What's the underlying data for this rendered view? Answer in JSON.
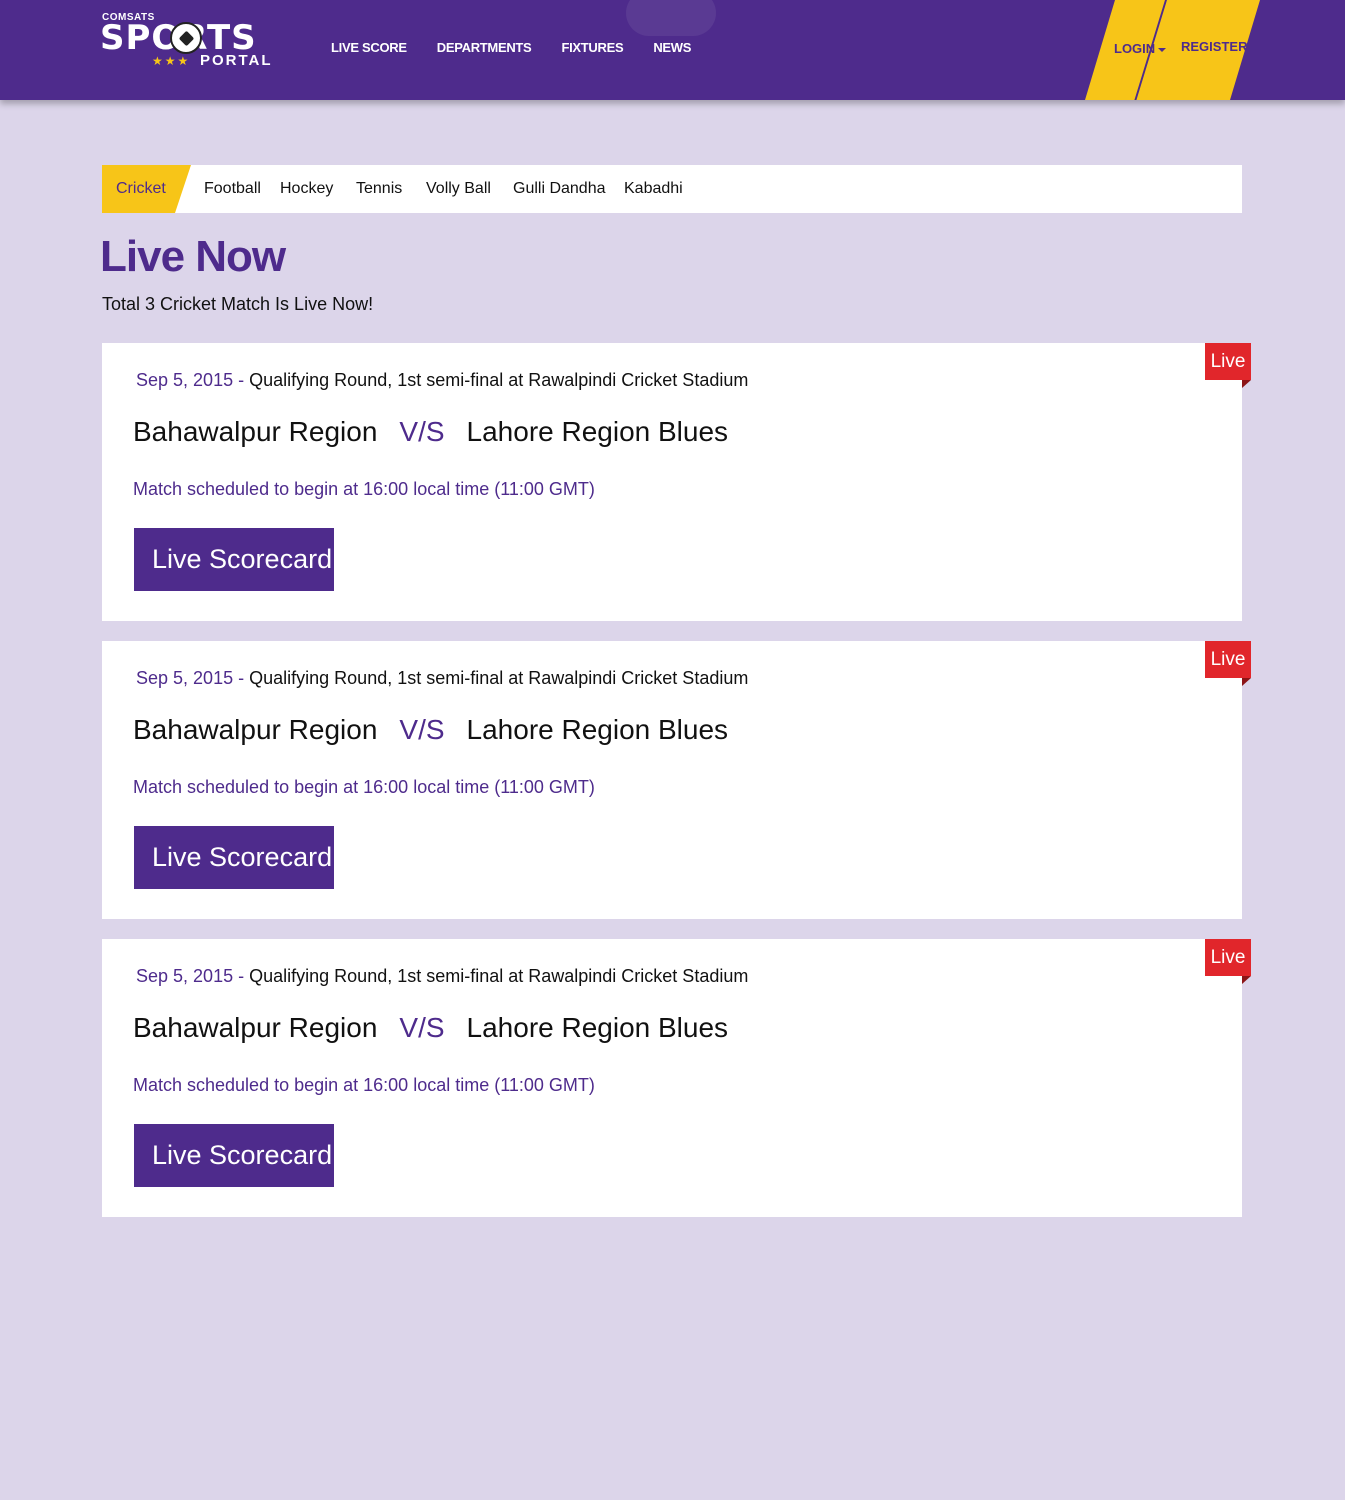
{
  "header": {
    "logo_small": "COMSATS",
    "logo_big": "SPORTS",
    "logo_portal": "PORTAL",
    "logo_stars": "★★★",
    "nav": [
      "LIVE SCORE",
      "DEPARTMENTS",
      "FIXTURES",
      "NEWS"
    ],
    "login": "LOGIN",
    "register": "REGISTER"
  },
  "tabs": [
    "Cricket",
    "Football",
    "Hockey",
    "Tennis",
    "Volly Ball",
    "Gulli Dandha",
    "Kabadhi"
  ],
  "active_tab": "Cricket",
  "page": {
    "title": "Live Now",
    "subtitle": "Total 3 Cricket Match Is Live Now!"
  },
  "matches": [
    {
      "badge": "Live",
      "date": "Sep 5, 2015",
      "separator": "-",
      "description": "Qualifying Round, 1st semi-final at Rawalpindi Cricket Stadium",
      "team_a": "Bahawalpur Region",
      "vs": "V/S",
      "team_b": "Lahore Region Blues",
      "schedule": "Match scheduled to begin at 16:00 local time (11:00 GMT)",
      "button": "Live Scorecard"
    },
    {
      "badge": "Live",
      "date": "Sep 5, 2015",
      "separator": "-",
      "description": "Qualifying Round, 1st semi-final at Rawalpindi Cricket Stadium",
      "team_a": "Bahawalpur Region",
      "vs": "V/S",
      "team_b": "Lahore Region Blues",
      "schedule": "Match scheduled to begin at 16:00 local time (11:00 GMT)",
      "button": "Live Scorecard"
    },
    {
      "badge": "Live",
      "date": "Sep 5, 2015",
      "separator": "-",
      "description": "Qualifying Round, 1st semi-final at Rawalpindi Cricket Stadium",
      "team_a": "Bahawalpur Region",
      "vs": "V/S",
      "team_b": "Lahore Region Blues",
      "schedule": "Match scheduled to begin at 16:00 local time (11:00 GMT)",
      "button": "Live Scorecard"
    }
  ],
  "colors": {
    "brand_purple": "#4e2b8c",
    "accent_yellow": "#f7c518",
    "live_red": "#e1262b",
    "page_bg": "#dcd5ea"
  },
  "icons": {
    "scorecard": "external-link-icon",
    "login": "caret-down-icon"
  }
}
